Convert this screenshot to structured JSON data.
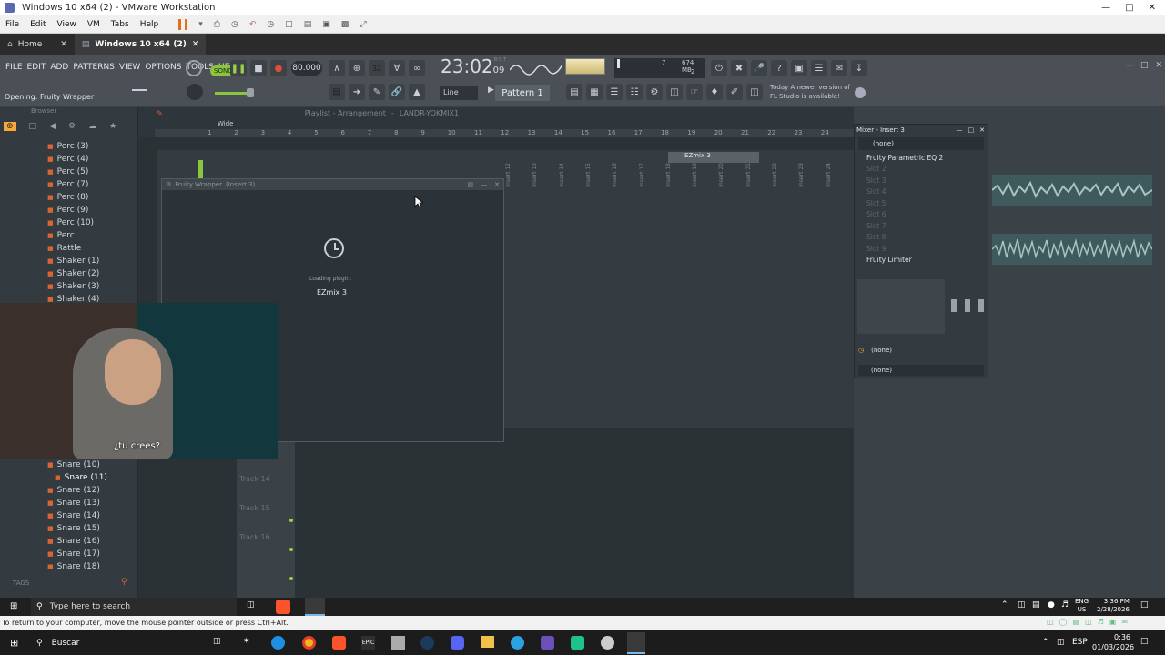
{
  "vm_window": {
    "title": "Windows 10 x64 (2) - VMware Workstation",
    "menu": [
      "File",
      "Edit",
      "View",
      "VM",
      "Tabs",
      "Help"
    ],
    "tabs": [
      {
        "label": "Home"
      },
      {
        "label": "Windows 10 x64 (2)"
      }
    ]
  },
  "fl": {
    "menu": [
      "FILE",
      "EDIT",
      "ADD",
      "PATTERNS",
      "VIEW",
      "OPTIONS",
      "TOOLS",
      "HELP"
    ],
    "song_mode": "SONG",
    "tempo": "80.000",
    "time_main": "23:02",
    "time_sub": "09",
    "time_unit": "B:S:T",
    "memory": "674 MB",
    "cpu_a": "7",
    "cpu_b": "2",
    "hint": "Opening: Fruity Wrapper",
    "snap": "Line",
    "pattern": "Pattern 1",
    "news_line1": "Today  A newer version of",
    "news_line2": "FL Studio is available!",
    "browser_title": "Browser",
    "browser_items": [
      "Perc (3)",
      "Perc (4)",
      "Perc (5)",
      "Perc (7)",
      "Perc (8)",
      "Perc (9)",
      "Perc (10)",
      "Perc",
      "Rattle",
      "Shaker (1)",
      "Shaker (2)",
      "Shaker (3)",
      "Shaker (4)"
    ],
    "browser_items_lower": [
      "Snare (10)",
      "Snare (11)",
      "Snare (12)",
      "Snare (13)",
      "Snare (14)",
      "Snare (15)",
      "Snare (16)",
      "Snare (17)",
      "Snare (18)"
    ],
    "tags_label": "TAGS",
    "playlist_title": "Playlist - Arrangement",
    "playlist_song": "LANDR-YOKMIX1",
    "playlist_zoom": "Wide",
    "timeline_numbers": [
      "1",
      "2",
      "3",
      "4",
      "5",
      "6",
      "7",
      "8",
      "9",
      "10",
      "11",
      "12",
      "13",
      "14",
      "15",
      "16",
      "17",
      "18",
      "19",
      "20",
      "21",
      "22",
      "23",
      "24"
    ],
    "tracks": [
      "Track 13",
      "Track 14",
      "Track 15",
      "Track 16"
    ],
    "mixer_title": "Mixer - Insert 3",
    "mixer_preset": "(none)",
    "mixer_slots": [
      {
        "label": "Fruity Parametric EQ 2",
        "on": true
      },
      {
        "label": "Slot 2",
        "on": false
      },
      {
        "label": "Slot 3",
        "on": false
      },
      {
        "label": "Slot 4",
        "on": false
      },
      {
        "label": "Slot 5",
        "on": false
      },
      {
        "label": "Slot 6",
        "on": false
      },
      {
        "label": "Slot 7",
        "on": false
      },
      {
        "label": "Slot 8",
        "on": false
      },
      {
        "label": "Slot 9",
        "on": false
      },
      {
        "label": "Fruity Limiter",
        "on": true
      }
    ],
    "mixer_out_a": "(none)",
    "mixer_out_b": "(none)",
    "mixer_insert_tag": "EZmix 3",
    "insert_labels": [
      "Insert 12",
      "Insert 13",
      "Insert 14",
      "Insert 15",
      "Insert 16",
      "Insert 17",
      "Insert 18",
      "Insert 19",
      "Insert 20",
      "Insert 21",
      "Insert 22",
      "Insert 23",
      "Insert 24"
    ],
    "plugin_title": "Fruity Wrapper",
    "plugin_sub": "(Insert 3)",
    "plugin_loading": "Loading plugin:",
    "plugin_name": "EZmix 3"
  },
  "webcam": {
    "subtitle": "¿tu crees?"
  },
  "guest_taskbar": {
    "search_placeholder": "Type here to search",
    "lang": "ENG",
    "region": "US",
    "time": "3:36 PM",
    "date": "2/28/2026"
  },
  "vm_status": "To return to your computer, move the mouse pointer outside or press Ctrl+Alt.",
  "host_taskbar": {
    "search_placeholder": "Buscar",
    "lang": "ESP",
    "time": "0:36",
    "date": "01/03/2026"
  },
  "colors": {
    "fl_bg": "#3b4247",
    "accent_orange": "#f7a83a",
    "accent_green": "#8bc53f"
  }
}
